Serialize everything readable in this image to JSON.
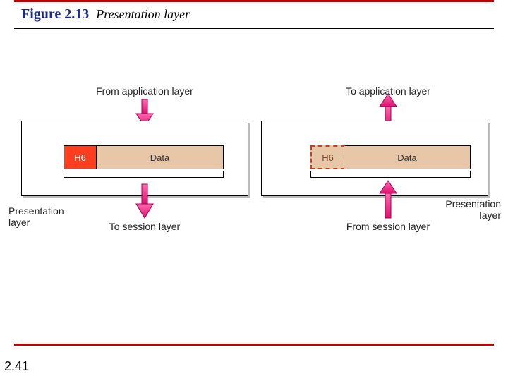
{
  "figure": {
    "number": "Figure 2.13",
    "title": "Presentation layer"
  },
  "page_number": "2.41",
  "left": {
    "top_label": "From application layer",
    "bottom_label": "To session layer",
    "side_label": "Presentation\nlayer",
    "header": "H6",
    "data": "Data"
  },
  "right": {
    "top_label": "To application layer",
    "bottom_label": "From session layer",
    "side_label": "Presentation\nlayer",
    "header": "H6",
    "data": "Data"
  },
  "colors": {
    "rule": "#c00000",
    "header_bg": "#ff3e1f",
    "data_bg": "#e8c6a8",
    "arrow": "#ff2a85"
  }
}
